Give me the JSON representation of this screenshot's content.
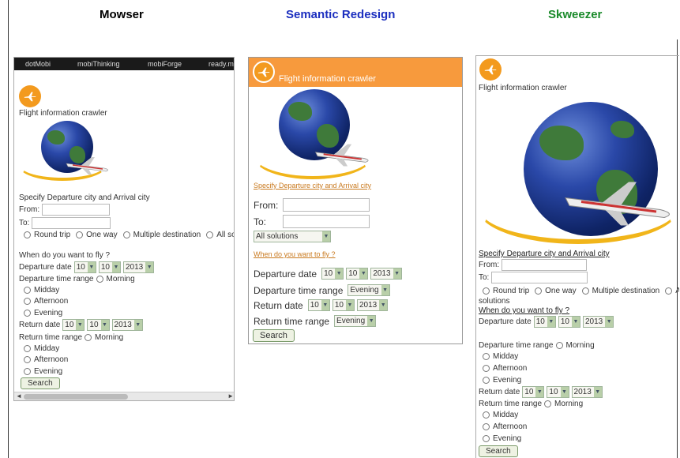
{
  "headings": {
    "mowser": "Mowser",
    "semantic": "Semantic Redesign",
    "skweezer": "Skweezer"
  },
  "common": {
    "title": "Flight information crawler",
    "specify": "Specify Departure city and Arrival city",
    "from": "From:",
    "to": "To:",
    "round_trip": "Round trip",
    "one_way": "One way",
    "multiple": "Multiple destination",
    "when": "When do you want to fly ?",
    "search": "Search",
    "day": "10",
    "month": "10",
    "year": "2013",
    "morning": "Morning",
    "midday": "Midday",
    "afternoon": "Afternoon",
    "evening": "Evening"
  },
  "mowser": {
    "nav": [
      "dotMobi",
      "mobiThinking",
      "mobiForge",
      "ready.m"
    ],
    "all_sol": "All sol",
    "departure_date": "Departure date",
    "departure_time_range": "Departure time range",
    "return_date": "Return date",
    "return_time_range": "Return time range"
  },
  "semantic": {
    "all_solutions": "All solutions",
    "departure_date": "Departure date",
    "departure_time_range": "Departure time range",
    "departure_time_value": "Evening",
    "return_date": "Return date",
    "return_time_range": "Return time range",
    "return_time_value": "Evening"
  },
  "skweezer": {
    "all": "Al",
    "solutions": "solutions",
    "departure_date": "Departure date",
    "departure_time_range": "Departure time range",
    "return_date": "Return date",
    "return_time_range": "Return time range"
  },
  "colors": {
    "orange": "#f39a1e",
    "mowser_heading": "#000000",
    "semantic_heading": "#1c2fbf",
    "skweezer_heading": "#1a8a2a"
  }
}
